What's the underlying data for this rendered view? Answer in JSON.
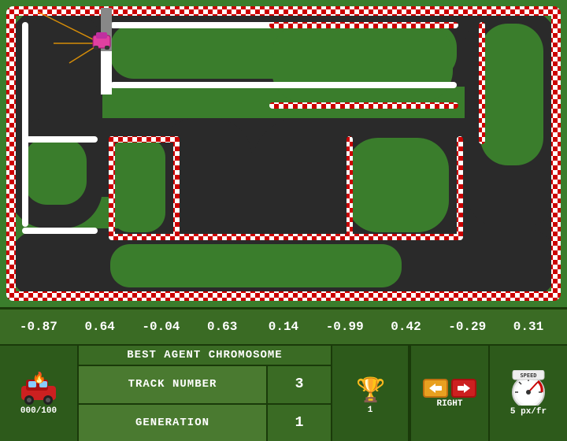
{
  "chromosome": {
    "values": [
      "-0.87",
      "0.64",
      "-0.04",
      "0.63",
      "0.14",
      "-0.99",
      "0.42",
      "-0.29",
      "0.31"
    ]
  },
  "best_agent_label": "BEST AGENT CHROMOSOME",
  "track_number_label": "TRACK NUMBER",
  "track_number_value": "3",
  "generation_label": "GENERATION",
  "generation_value": "1",
  "agent_score": "000/100",
  "trophy_count": "1",
  "direction": "RIGHT",
  "speed": "5 px/fr",
  "direction_label": "RIGHT",
  "speed_label": "5 px/fr"
}
